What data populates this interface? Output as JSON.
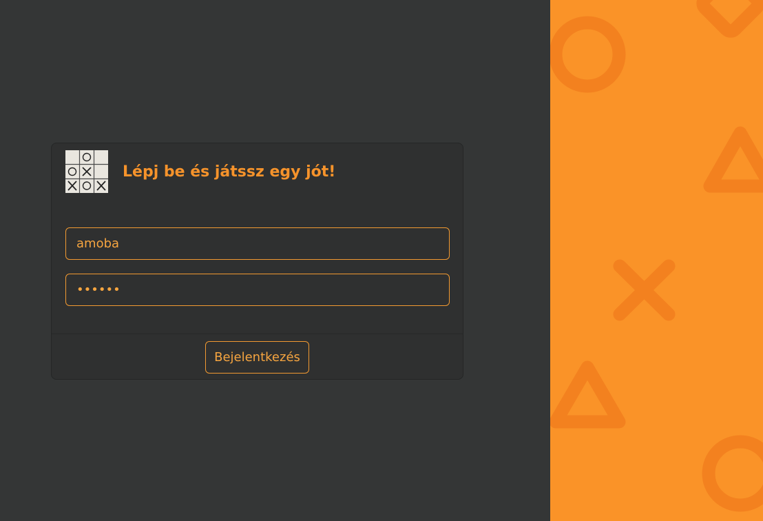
{
  "login": {
    "title": "Lépj be és játssz egy jót!",
    "username_value": "amoba",
    "password_mask": "••••••",
    "submit_label": "Bejelentkezés"
  },
  "colors": {
    "accent": "#f6932b",
    "background": "#343636",
    "card": "#2f3030",
    "panel": "#fa9328",
    "panel_shapes": "#f3811f"
  },
  "icons": {
    "logo": "tic-tac-toe-board-icon",
    "decorations": [
      "circle-icon",
      "diamond-icon",
      "triangle-icon",
      "cross-icon",
      "triangle-icon",
      "circle-icon"
    ]
  }
}
